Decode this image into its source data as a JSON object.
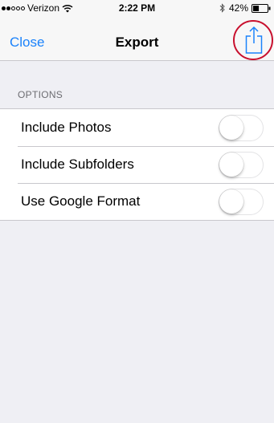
{
  "status_bar": {
    "signal_full": 2,
    "signal_empty": 3,
    "carrier": "Verizon",
    "time": "2:22 PM",
    "battery": "42%",
    "battery_level": 0.42
  },
  "nav": {
    "close_label": "Close",
    "title": "Export",
    "share_icon": "share-icon"
  },
  "options": {
    "header": "OPTIONS",
    "items": [
      {
        "label": "Include Photos",
        "on": false
      },
      {
        "label": "Include Subfolders",
        "on": false
      },
      {
        "label": "Use Google Format",
        "on": false
      }
    ]
  },
  "colors": {
    "accent": "#1a82fb",
    "annotation": "#c8102e",
    "background": "#efeff4"
  }
}
